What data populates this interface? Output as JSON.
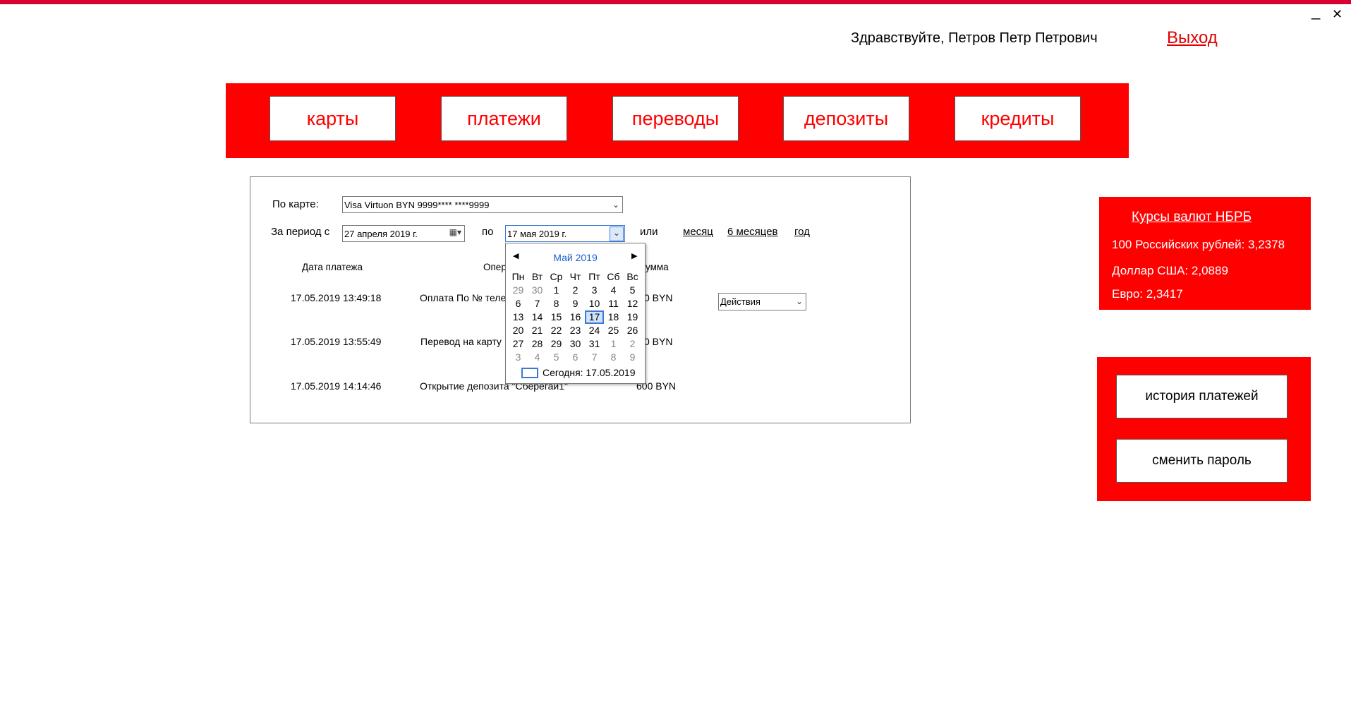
{
  "window": {
    "minimize_label": "_",
    "close_label": "✕"
  },
  "header": {
    "greeting": "Здравствуйте, Петров Петр Петрович",
    "logout": "Выход"
  },
  "nav": {
    "items": [
      "карты",
      "платежи",
      "переводы",
      "депозиты",
      "кредиты"
    ]
  },
  "filter": {
    "card_label": "По карте:",
    "card_value": "Visa Virtuon BYN 9999**** ****9999",
    "period_label": "За период с",
    "date_from": "27  апреля   2019 г.",
    "to_label": "по",
    "date_to": "17    мая      2019 г.",
    "or_label": "или",
    "quick_links": [
      "месяц",
      "6 месяцев",
      "год"
    ]
  },
  "table": {
    "headers": {
      "date": "Дата платежа",
      "operation": "Опер",
      "amount": "умма"
    },
    "rows": [
      {
        "date": "17.05.2019 13:49:18",
        "operation": "Оплата По № теле",
        "amount": "0 BYN"
      },
      {
        "date": "17.05.2019 13:55:49",
        "operation": "Перевод на карту",
        "amount": "0 BYN"
      },
      {
        "date": "17.05.2019 14:14:46",
        "operation": "Открытие депозита \"Сберегай1\"",
        "amount": "600 BYN"
      }
    ],
    "actions_value": "Действия"
  },
  "calendar": {
    "title": "Май 2019",
    "weekdays": [
      "Пн",
      "Вт",
      "Ср",
      "Чт",
      "Пт",
      "Сб",
      "Вс"
    ],
    "weeks": [
      [
        "29",
        "30",
        "1",
        "2",
        "3",
        "4",
        "5"
      ],
      [
        "6",
        "7",
        "8",
        "9",
        "10",
        "11",
        "12"
      ],
      [
        "13",
        "14",
        "15",
        "16",
        "17",
        "18",
        "19"
      ],
      [
        "20",
        "21",
        "22",
        "23",
        "24",
        "25",
        "26"
      ],
      [
        "27",
        "28",
        "29",
        "30",
        "31",
        "1",
        "2"
      ],
      [
        "3",
        "4",
        "5",
        "6",
        "7",
        "8",
        "9"
      ]
    ],
    "selected_day": "17",
    "today_label": "Сегодня: 17.05.2019"
  },
  "rates": {
    "title": "Курсы валют НБРБ",
    "items": [
      "100 Российских рублей: 3,2378",
      "Доллар США: 2,0889",
      "Евро: 2,3417"
    ]
  },
  "actions": {
    "history": "история платежей",
    "change_password": "сменить пароль"
  },
  "colors": {
    "accent": "#ff0000",
    "topbar": "#d80032",
    "calendar_title": "#1e5fd0"
  }
}
